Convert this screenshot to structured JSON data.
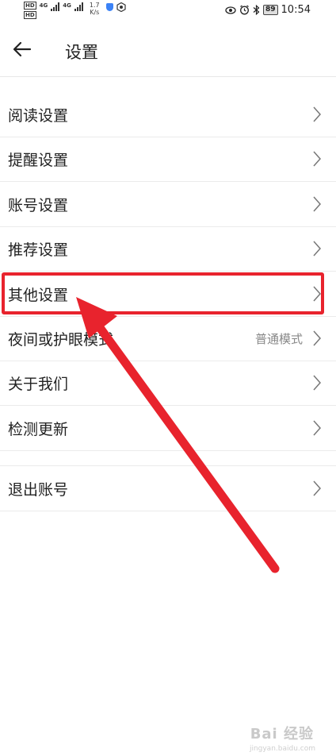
{
  "status_bar": {
    "network_speed_value": "1.7",
    "network_speed_unit": "K/s",
    "battery": "89",
    "time": "10:54"
  },
  "header": {
    "title": "设置"
  },
  "items": [
    {
      "label": "阅读设置"
    },
    {
      "label": "提醒设置"
    },
    {
      "label": "账号设置"
    },
    {
      "label": "推荐设置"
    },
    {
      "label": "其他设置"
    },
    {
      "label": "夜间或护眼模式",
      "value": "普通模式"
    },
    {
      "label": "关于我们"
    },
    {
      "label": "检测更新"
    },
    {
      "label": "退出账号"
    }
  ],
  "annotation": {
    "color": "#e8232d"
  },
  "watermark": {
    "brand": "Bai 经验",
    "url": "jingyan.baidu.com"
  }
}
